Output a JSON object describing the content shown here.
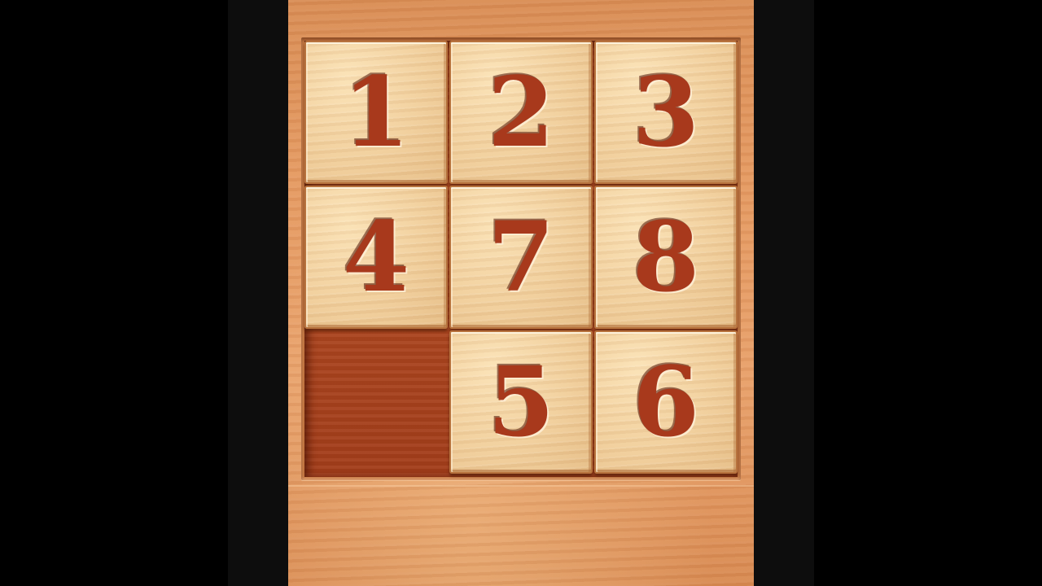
{
  "game": {
    "grid": {
      "rows": 3,
      "cols": 3
    },
    "tiles": [
      {
        "number": "1"
      },
      {
        "number": "2"
      },
      {
        "number": "3"
      },
      {
        "number": "4"
      },
      {
        "number": "7"
      },
      {
        "number": "8"
      },
      {
        "number": "5"
      },
      {
        "number": "6"
      }
    ],
    "empty_cell": {
      "row": 3,
      "col": 1
    },
    "colors": {
      "background": "#e59a62",
      "tile_face": "#f1cf9c",
      "numeral": "#a8391c",
      "board_well": "#a8441f",
      "pillars": "#0d0d0d"
    }
  }
}
